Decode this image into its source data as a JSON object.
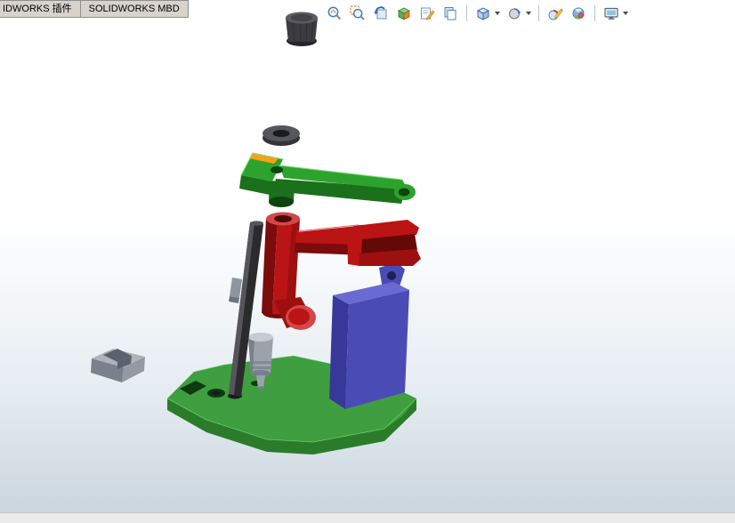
{
  "tabs": [
    {
      "label": "IDWORKS 插件"
    },
    {
      "label": "SOLIDWORKS MBD"
    }
  ],
  "toolbar": {
    "items": [
      {
        "icon": "zoom-to-fit-icon",
        "dropdown": false
      },
      {
        "icon": "zoom-to-area-icon",
        "dropdown": false
      },
      {
        "icon": "previous-view-icon",
        "dropdown": false
      },
      {
        "icon": "section-view-icon",
        "dropdown": false
      },
      {
        "icon": "3d-drawing-view-icon",
        "dropdown": false
      },
      {
        "icon": "hide-show-items-icon",
        "dropdown": false
      },
      {
        "icon": "view-orientation-icon",
        "dropdown": true
      },
      {
        "icon": "display-style-icon",
        "dropdown": true
      },
      {
        "icon": "edit-appearance-icon",
        "dropdown": false
      },
      {
        "icon": "apply-scene-icon",
        "dropdown": false
      },
      {
        "icon": "view-settings-icon",
        "dropdown": true
      }
    ]
  },
  "viewport": {
    "content": "exploded view of clamp assembly",
    "background_top": "#ffffff",
    "background_bottom": "#c9d4dd",
    "part_colors": {
      "base_top": "#3f9e3f",
      "base_front": "#2a7c2a",
      "base_hole": "#0f3a0f",
      "arm_top": "#2da32d",
      "arm_side": "#1b701b",
      "arm_dark": "#0e440e",
      "arm_edge": "#79e079",
      "orange": "#ff9e1c",
      "red_light": "#d24848",
      "red_main": "#bb1414",
      "red_mid": "#9e1010",
      "red_dark": "#7c0b0b",
      "red_slot": "#650808",
      "red_hole": "#4e0606",
      "rod": "#2b2b2e",
      "rod_light": "#55555b",
      "clip": "#8e95a0",
      "clip_dark": "#6d737e",
      "piston_light": "#c6cbd3",
      "piston_main": "#9ba2ac",
      "piston_dark": "#78808b",
      "block_top": "#6a6ad2",
      "block_front": "#4b4bb6",
      "block_side": "#38389a",
      "block_hole": "#1e1e58",
      "vblock_top": "#adb3bd",
      "vblock_front": "#7a818c",
      "vblock_side": "#939aa4",
      "vblock_groove": "#5b626d",
      "knob_top": "#5a5a61",
      "knob_body": "#3b3b40",
      "knob_dark": "#26262a",
      "knob_inner": "#434349",
      "washer_top": "#56565d",
      "washer_side": "#333338",
      "washer_hole": "#1b1b1e"
    }
  }
}
